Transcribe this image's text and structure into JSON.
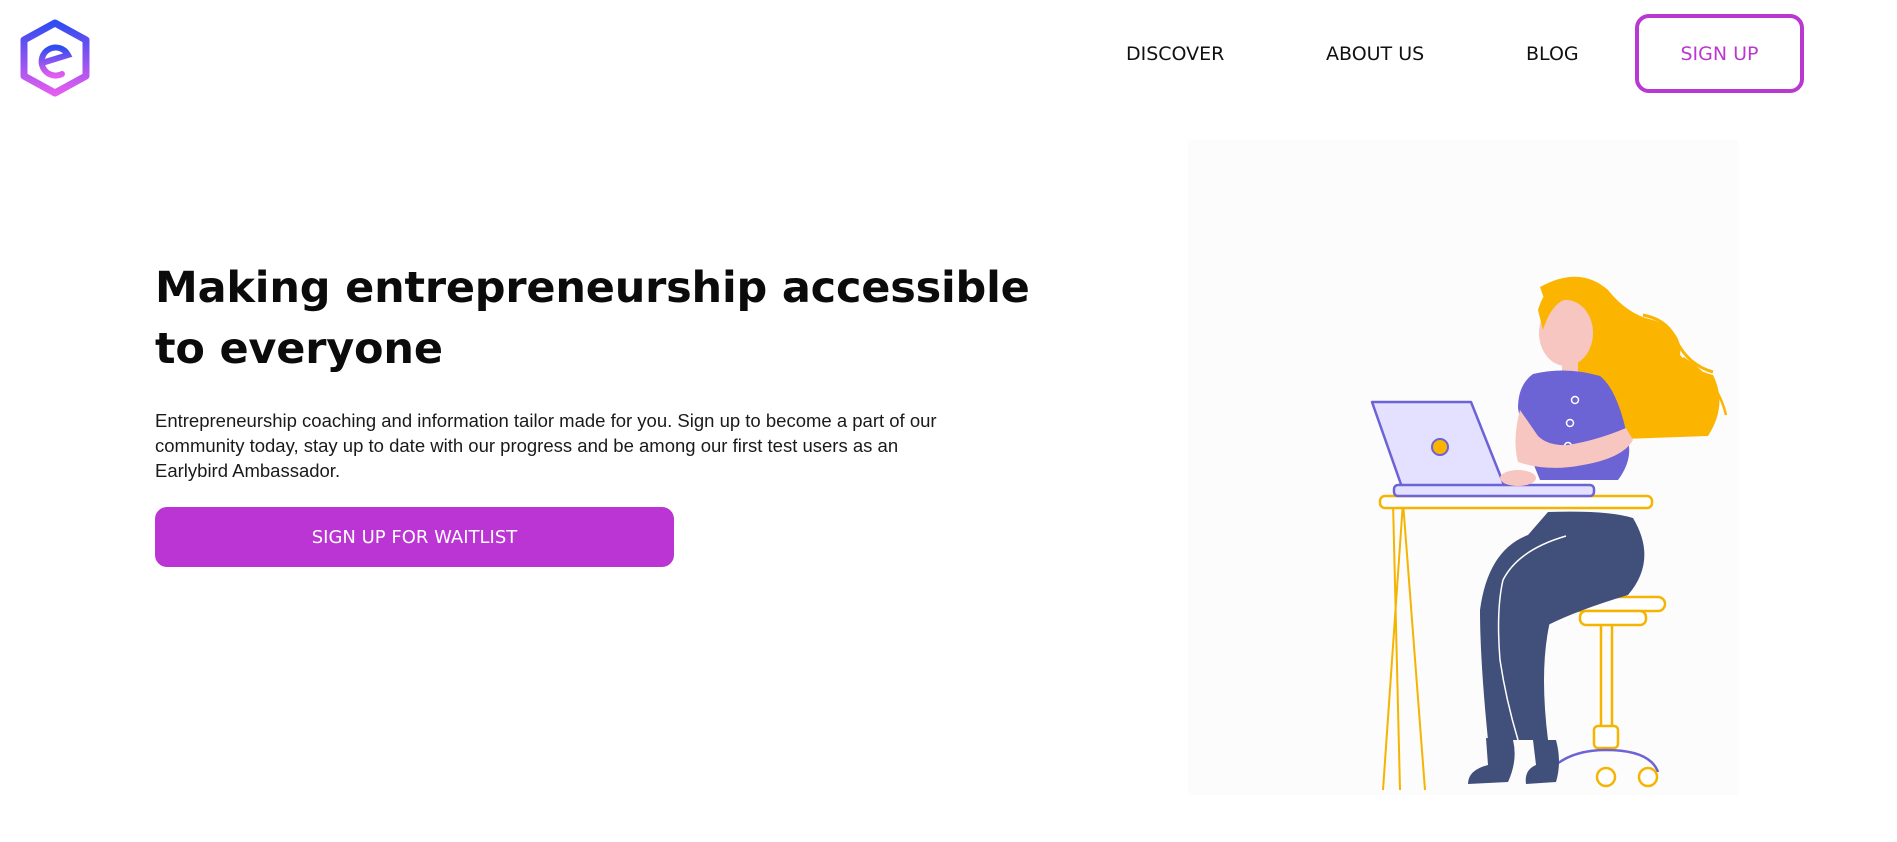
{
  "header": {
    "logo_icon": "hexagon-e-logo-icon",
    "nav": {
      "discover": "DISCOVER",
      "about": "ABOUT US",
      "blog": "BLOG",
      "signup": "SIGN UP"
    }
  },
  "hero": {
    "title": "Making entrepreneurship accessible to everyone",
    "description": "Entrepreneurship coaching and information tailor made for you. Sign up to become a part of our community today, stay up to date with our progress and be among our first test users as an Earlybird Ambassador.",
    "cta_label": "SIGN UP FOR WAITLIST",
    "illustration": "woman-working-on-laptop-illustration"
  },
  "colors": {
    "accent": "#bb35d4",
    "logo_gradient_start": "#2f4cf0",
    "logo_gradient_end": "#e45cf0",
    "illustration_hair": "#fbb400",
    "illustration_shirt": "#6c63d5",
    "illustration_pants": "#414f7b",
    "illustration_furniture": "#f5b400"
  }
}
